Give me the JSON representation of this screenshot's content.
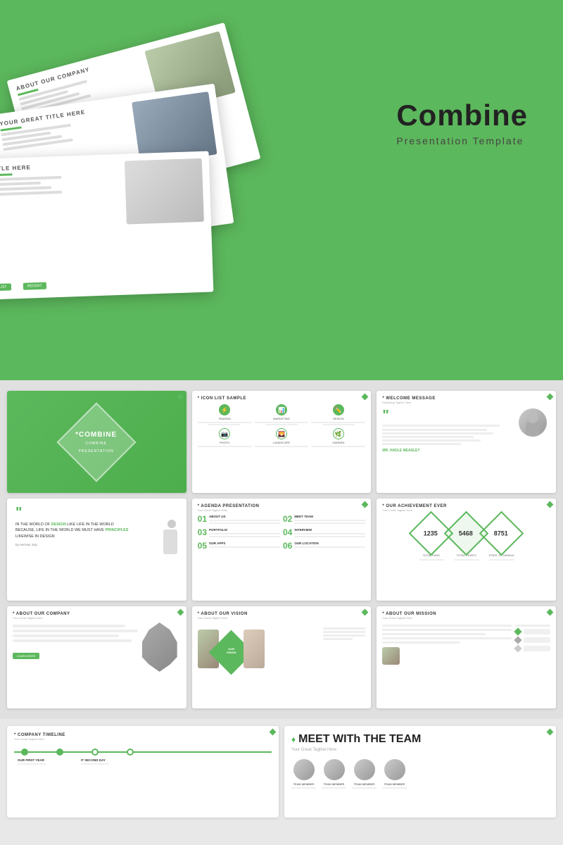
{
  "header": {
    "title": "Combine",
    "subtitle": "Presentation Template",
    "bg_color": "#5cb85c"
  },
  "slides_preview": {
    "stack_labels": [
      "ABOUT OUR COMPANY",
      "YOUR GREAT TITLE HERE",
      "TITLE HERE"
    ]
  },
  "slide_grid": [
    {
      "id": "combine-title",
      "type": "title",
      "text": "*COMBINE",
      "sub": "COMBINE PRESENTATION TEMPLATE"
    },
    {
      "id": "quote-slide",
      "type": "quote",
      "quote": "IN THE WORLD OF DESIGN LIKE LIFE IN THE WORLD BECAUSE, LIFE IN THE WORLD WE MUST HAVE PRINCIPLES LIKEWISE IN DESIGN",
      "author": "by Aerman July",
      "highlights": [
        "DESIGN",
        "PRINCIPLES"
      ]
    },
    {
      "id": "about-company",
      "type": "about-company",
      "title": "* ABOUT OUR COMPANY",
      "tagline": "Your Great Tagline Here"
    },
    {
      "id": "icon-list",
      "type": "icon-list",
      "title": "* ICON LIST SAMPLE",
      "items": [
        "TRADING",
        "MARKETING",
        "DESIGN",
        "PHOTO",
        "LANDSCAPE",
        "GARDEN"
      ]
    },
    {
      "id": "agenda",
      "type": "agenda",
      "title": "* AGENDA PRESENTATION",
      "tagline": "Your Great Tagline Here",
      "items": [
        {
          "num": "01",
          "label": "ABOUT US"
        },
        {
          "num": "02",
          "label": "MEET TEAM"
        },
        {
          "num": "03",
          "label": "PORTFOLIO"
        },
        {
          "num": "04",
          "label": "INTERVIEW"
        },
        {
          "num": "05",
          "label": "OUR APPS"
        },
        {
          "num": "06",
          "label": "OUR LOCATION"
        }
      ]
    },
    {
      "id": "about-vision",
      "type": "about-vision",
      "title": "* ABOUT OUR VISION",
      "tagline": "Your Great Tagline Here",
      "diamond_text": "OUR VISION"
    },
    {
      "id": "welcome",
      "type": "welcome",
      "title": "* WELCOME MESSAGE",
      "tagline": "Marketing Tagline Here",
      "person_name": "MR. HADLE MEASLEY"
    },
    {
      "id": "achievement",
      "type": "achievement",
      "title": "* OUR ACHIEVEMENT EVER",
      "tagline": "Your Great Tagline Here",
      "stats": [
        {
          "num": "1235",
          "label": "TOTAL FANS"
        },
        {
          "num": "5468",
          "label": "TOTAL PRINTS"
        },
        {
          "num": "8751",
          "label": "STATE TO HANDLE"
        }
      ]
    },
    {
      "id": "about-mission",
      "type": "about-mission",
      "title": "* ABOUT OUR MISSION",
      "tagline": "Your Great Tagline Here"
    }
  ],
  "bottom_slides": [
    {
      "id": "timeline",
      "title": "* COMPANY TIMELINE",
      "tagline": "Your Great Tagline Here",
      "milestones": [
        "OUR FIRST YEAR",
        "IT SECOND DAY"
      ]
    },
    {
      "id": "meet-team",
      "title": "MEET WITh THE TEAM",
      "tagline": "Your Great Tagline Here",
      "diamond_prefix": "♦"
    }
  ]
}
